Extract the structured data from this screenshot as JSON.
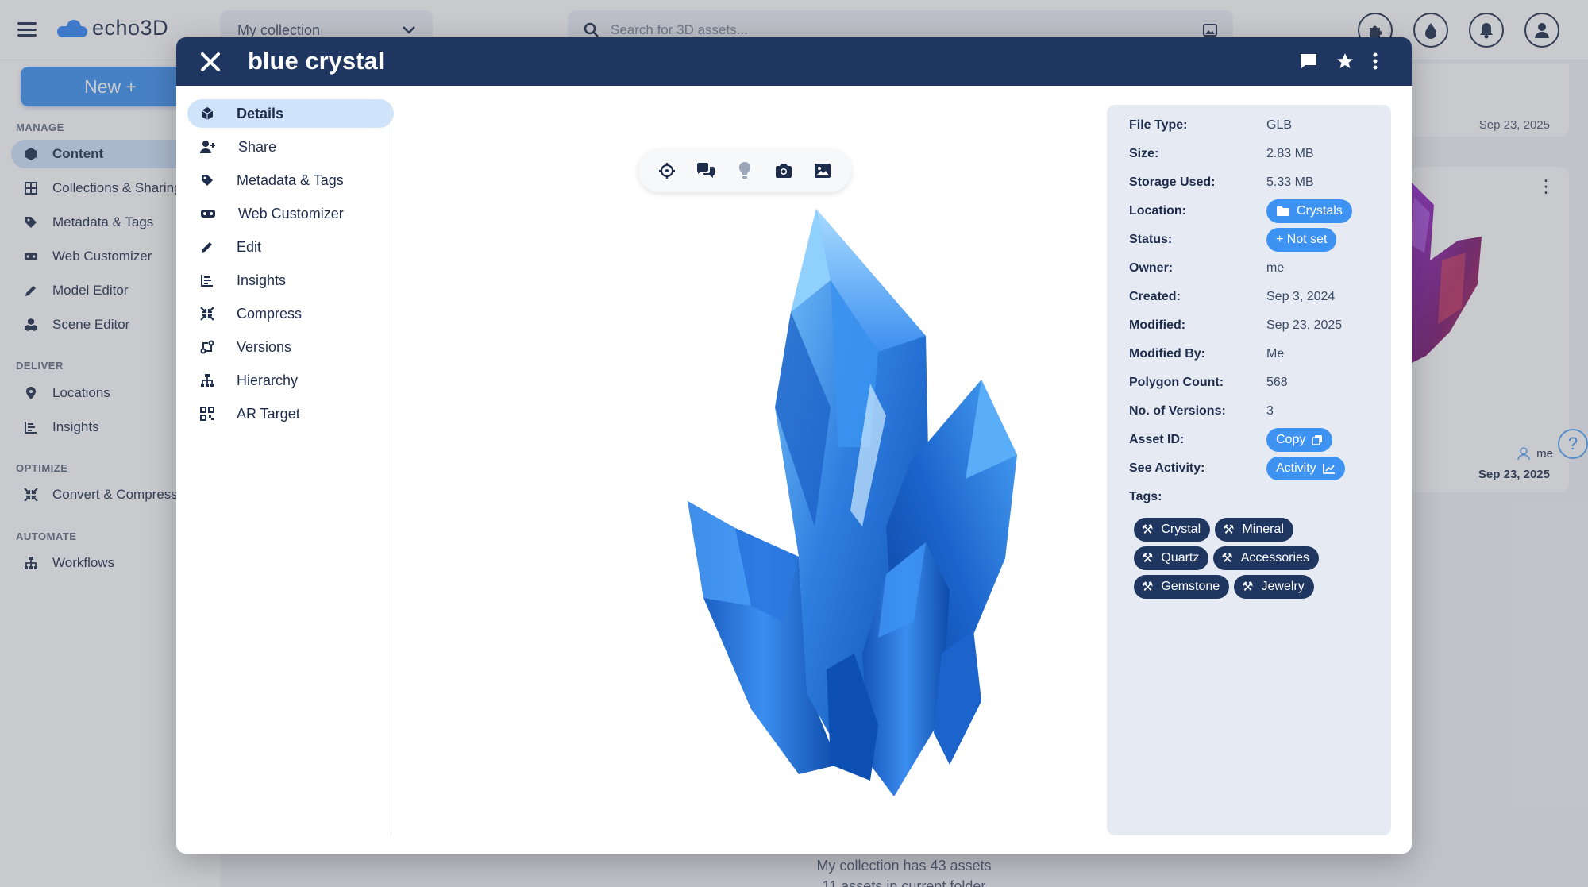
{
  "app": {
    "logo_text": "echo3D",
    "collection_select": "My collection",
    "search_placeholder": "Search for 3D assets..."
  },
  "sidebar": {
    "new_button": "New +",
    "sections": {
      "manage": "MANAGE",
      "deliver": "DELIVER",
      "optimize": "OPTIMIZE",
      "automate": "AUTOMATE"
    },
    "items": [
      {
        "label": "Content",
        "icon": "cube-icon"
      },
      {
        "label": "Collections & Sharing",
        "icon": "grid-icon"
      },
      {
        "label": "Metadata & Tags",
        "icon": "tag-icon"
      },
      {
        "label": "Web Customizer",
        "icon": "vr-headset-icon"
      },
      {
        "label": "Model Editor",
        "icon": "pencil-icon"
      },
      {
        "label": "Scene Editor",
        "icon": "cubes-icon"
      },
      {
        "label": "Locations",
        "icon": "location-pin-icon"
      },
      {
        "label": "Insights",
        "icon": "bar-chart-icon"
      },
      {
        "label": "Convert & Compress",
        "icon": "compress-icon"
      },
      {
        "label": "Workflows",
        "icon": "sitemap-icon"
      }
    ]
  },
  "background_cards": {
    "top_card_date": "Sep 23, 2025",
    "card_owner": "me",
    "card_date": "Sep 23, 2025"
  },
  "footer": {
    "asset_count": "My collection has 43 assets",
    "folder_count": "11 assets in current folder"
  },
  "modal": {
    "title": "blue crystal",
    "nav": [
      {
        "label": "Details",
        "icon": "cube-icon"
      },
      {
        "label": "Share",
        "icon": "user-plus-icon"
      },
      {
        "label": "Metadata & Tags",
        "icon": "tag-icon"
      },
      {
        "label": "Web Customizer",
        "icon": "vr-headset-icon"
      },
      {
        "label": "Edit",
        "icon": "pencil-icon"
      },
      {
        "label": "Insights",
        "icon": "bar-chart-icon"
      },
      {
        "label": "Compress",
        "icon": "compress-icon"
      },
      {
        "label": "Versions",
        "icon": "versions-icon"
      },
      {
        "label": "Hierarchy",
        "icon": "sitemap-icon"
      },
      {
        "label": "AR Target",
        "icon": "qr-code-icon"
      }
    ],
    "viewer_toolbar": [
      "crosshair-icon",
      "comments-icon",
      "lightbulb-icon",
      "camera-icon",
      "image-icon"
    ],
    "details": {
      "file_type": {
        "label": "File Type:",
        "value": "GLB"
      },
      "size": {
        "label": "Size:",
        "value": "2.83 MB"
      },
      "storage_used": {
        "label": "Storage Used:",
        "value": "5.33 MB"
      },
      "location": {
        "label": "Location:",
        "value": "Crystals"
      },
      "status": {
        "label": "Status:",
        "value": "+ Not set"
      },
      "owner": {
        "label": "Owner:",
        "value": "me"
      },
      "created": {
        "label": "Created:",
        "value": "Sep 3, 2024"
      },
      "modified": {
        "label": "Modified:",
        "value": "Sep 23, 2025"
      },
      "modified_by": {
        "label": "Modified By:",
        "value": "Me"
      },
      "polygon_count": {
        "label": "Polygon Count:",
        "value": "568"
      },
      "versions": {
        "label": "No. of Versions:",
        "value": "3"
      },
      "asset_id": {
        "label": "Asset ID:",
        "value": "Copy"
      },
      "activity": {
        "label": "See Activity:",
        "value": "Activity"
      },
      "tags_label": "Tags:"
    },
    "tags": [
      "Crystal",
      "Mineral",
      "Quartz",
      "Accessories",
      "Gemstone",
      "Jewelry"
    ]
  },
  "colors": {
    "header_navy": "#1f3661",
    "accent_blue": "#3e93f2",
    "active_nav_bg": "#cfe4fb",
    "details_panel_bg": "#e6ebf3"
  }
}
